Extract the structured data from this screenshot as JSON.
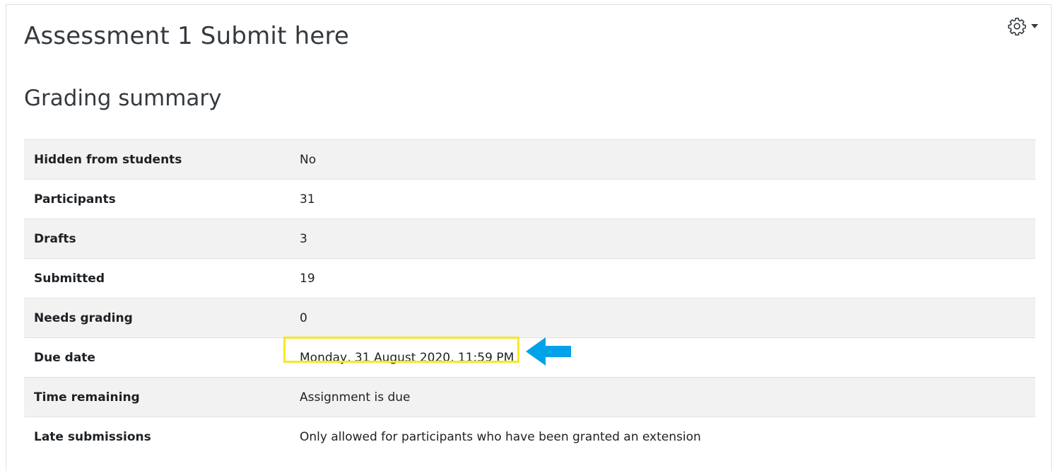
{
  "page": {
    "title": "Assessment 1 Submit here",
    "settings_icon": "gear-icon",
    "settings_dropdown_icon": "caret-down-icon"
  },
  "grading_summary": {
    "heading": "Grading summary",
    "rows": [
      {
        "label": "Hidden from students",
        "value": "No"
      },
      {
        "label": "Participants",
        "value": "31"
      },
      {
        "label": "Drafts",
        "value": "3"
      },
      {
        "label": "Submitted",
        "value": "19"
      },
      {
        "label": "Needs grading",
        "value": "0"
      },
      {
        "label": "Due date",
        "value": "Monday, 31 August 2020, 11:59 PM"
      },
      {
        "label": "Time remaining",
        "value": "Assignment is due"
      },
      {
        "label": "Late submissions",
        "value": "Only allowed for participants who have been granted an extension"
      }
    ]
  },
  "annotation": {
    "highlight_color": "#f5e823",
    "arrow_color": "#00a2e8",
    "arrow_icon": "arrow-left-icon"
  }
}
